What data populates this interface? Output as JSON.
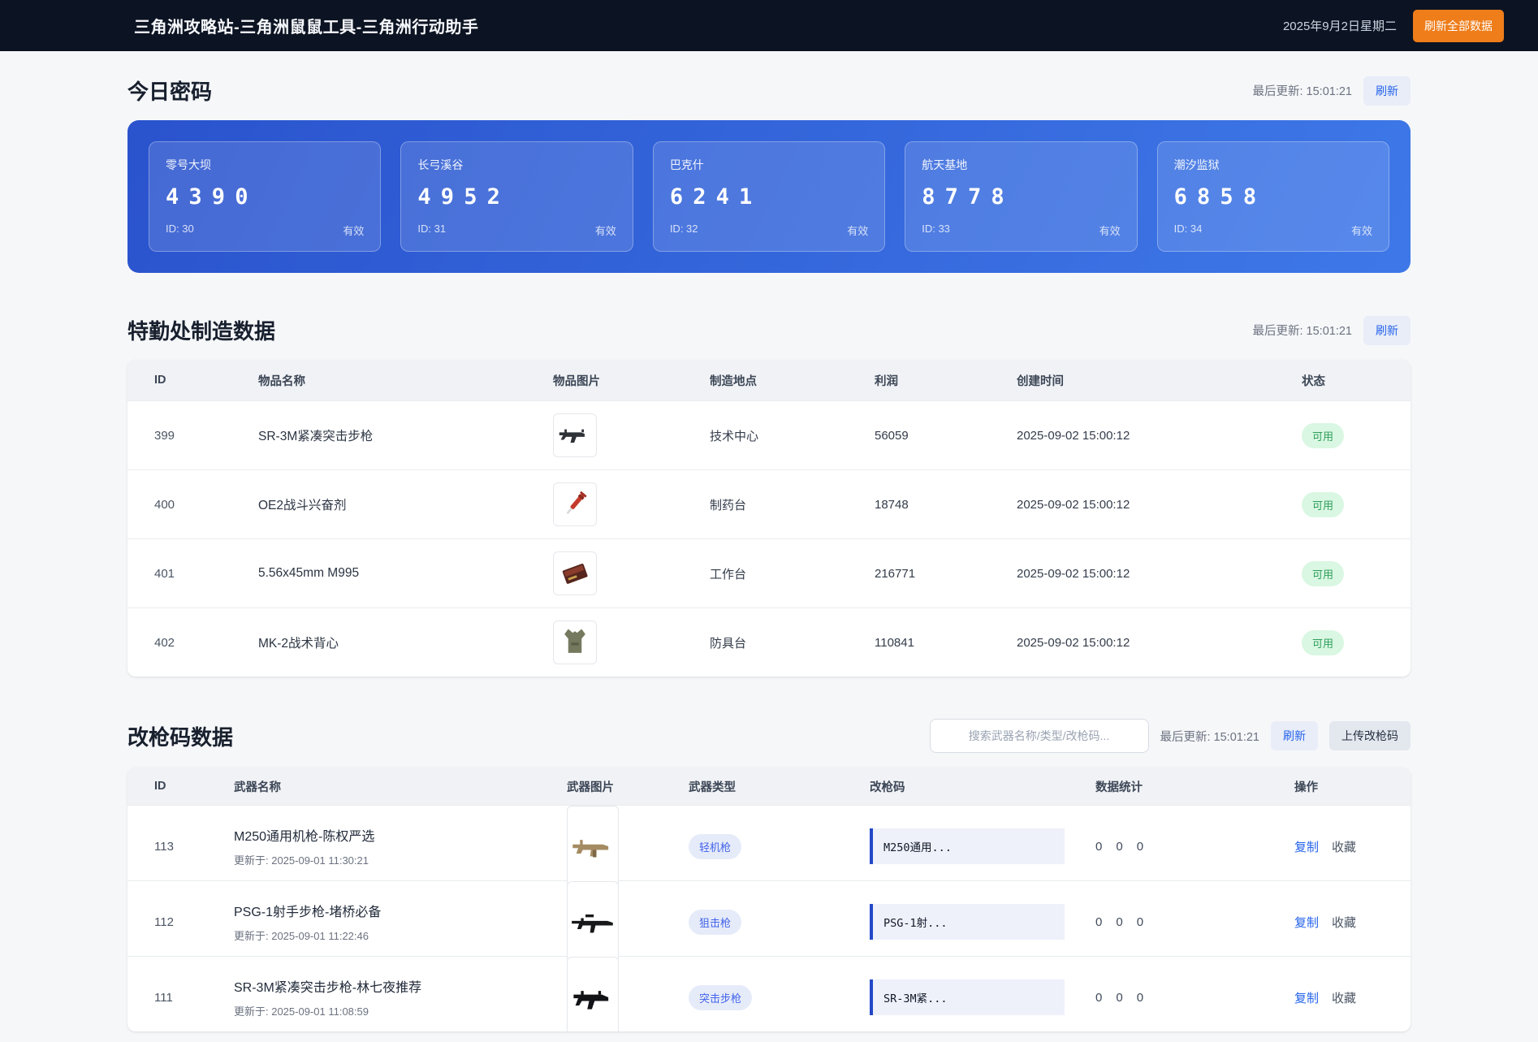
{
  "header": {
    "title": "三角洲攻略站-三角洲鼠鼠工具-三角洲行动助手",
    "date": "2025年9月2日星期二",
    "refresh_all_label": "刷新全部数据"
  },
  "passwords": {
    "title": "今日密码",
    "last_update_label": "最后更新: 15:01:21",
    "refresh_label": "刷新",
    "cards": [
      {
        "map": "零号大坝",
        "code": "4390",
        "id_label": "ID: 30",
        "status": "有效"
      },
      {
        "map": "长弓溪谷",
        "code": "4952",
        "id_label": "ID: 31",
        "status": "有效"
      },
      {
        "map": "巴克什",
        "code": "6241",
        "id_label": "ID: 32",
        "status": "有效"
      },
      {
        "map": "航天基地",
        "code": "8778",
        "id_label": "ID: 33",
        "status": "有效"
      },
      {
        "map": "潮汐监狱",
        "code": "6858",
        "id_label": "ID: 34",
        "status": "有效"
      }
    ]
  },
  "manufacture": {
    "title": "特勤处制造数据",
    "last_update_label": "最后更新: 15:01:21",
    "refresh_label": "刷新",
    "columns": {
      "id": "ID",
      "name": "物品名称",
      "image": "物品图片",
      "location": "制造地点",
      "profit": "利润",
      "created": "创建时间",
      "status": "状态"
    },
    "rows": [
      {
        "id": "399",
        "name": "SR-3M紧凑突击步枪",
        "icon": "rifle-icon",
        "location": "技术中心",
        "profit": "56059",
        "created": "2025-09-02 15:00:12",
        "status": "可用"
      },
      {
        "id": "400",
        "name": "OE2战斗兴奋剂",
        "icon": "syringe-icon",
        "location": "制药台",
        "profit": "18748",
        "created": "2025-09-02 15:00:12",
        "status": "可用"
      },
      {
        "id": "401",
        "name": "5.56x45mm M995",
        "icon": "ammo-icon",
        "location": "工作台",
        "profit": "216771",
        "created": "2025-09-02 15:00:12",
        "status": "可用"
      },
      {
        "id": "402",
        "name": "MK-2战术背心",
        "icon": "vest-icon",
        "location": "防具台",
        "profit": "110841",
        "created": "2025-09-02 15:00:12",
        "status": "可用"
      }
    ]
  },
  "modcodes": {
    "title": "改枪码数据",
    "search_placeholder": "搜索武器名称/类型/改枪码...",
    "last_update_label": "最后更新: 15:01:21",
    "refresh_label": "刷新",
    "upload_label": "上传改枪码",
    "columns": {
      "id": "ID",
      "name": "武器名称",
      "image": "武器图片",
      "type": "武器类型",
      "code": "改枪码",
      "stats": "数据统计",
      "actions": "操作"
    },
    "copy_label": "复制",
    "favorite_label": "收藏",
    "rows": [
      {
        "id": "113",
        "name": "M250通用机枪-陈权严选",
        "updated": "更新于: 2025-09-01 11:30:21",
        "icon": "lmg-gun-icon",
        "type": "轻机枪",
        "code": "M250通用...",
        "stats": [
          "0",
          "0",
          "0"
        ]
      },
      {
        "id": "112",
        "name": "PSG-1射手步枪-堵桥必备",
        "updated": "更新于: 2025-09-01 11:22:46",
        "icon": "sniper-gun-icon",
        "type": "狙击枪",
        "code": "PSG-1射...",
        "stats": [
          "0",
          "0",
          "0"
        ]
      },
      {
        "id": "111",
        "name": "SR-3M紧凑突击步枪-林七夜推荐",
        "updated": "更新于: 2025-09-01 11:08:59",
        "icon": "ar-gun-icon",
        "type": "突击步枪",
        "code": "SR-3M紧...",
        "stats": [
          "0",
          "0",
          "0"
        ]
      }
    ]
  },
  "colors": {
    "header_bg": "#0c1322",
    "accent_orange": "#ee7d1a",
    "accent_blue": "#2563eb",
    "panel_gradient_start": "#2a53cd",
    "panel_gradient_end": "#3e78e8",
    "status_green_bg": "#d9f7e2",
    "status_green_text": "#2f9e5b"
  }
}
